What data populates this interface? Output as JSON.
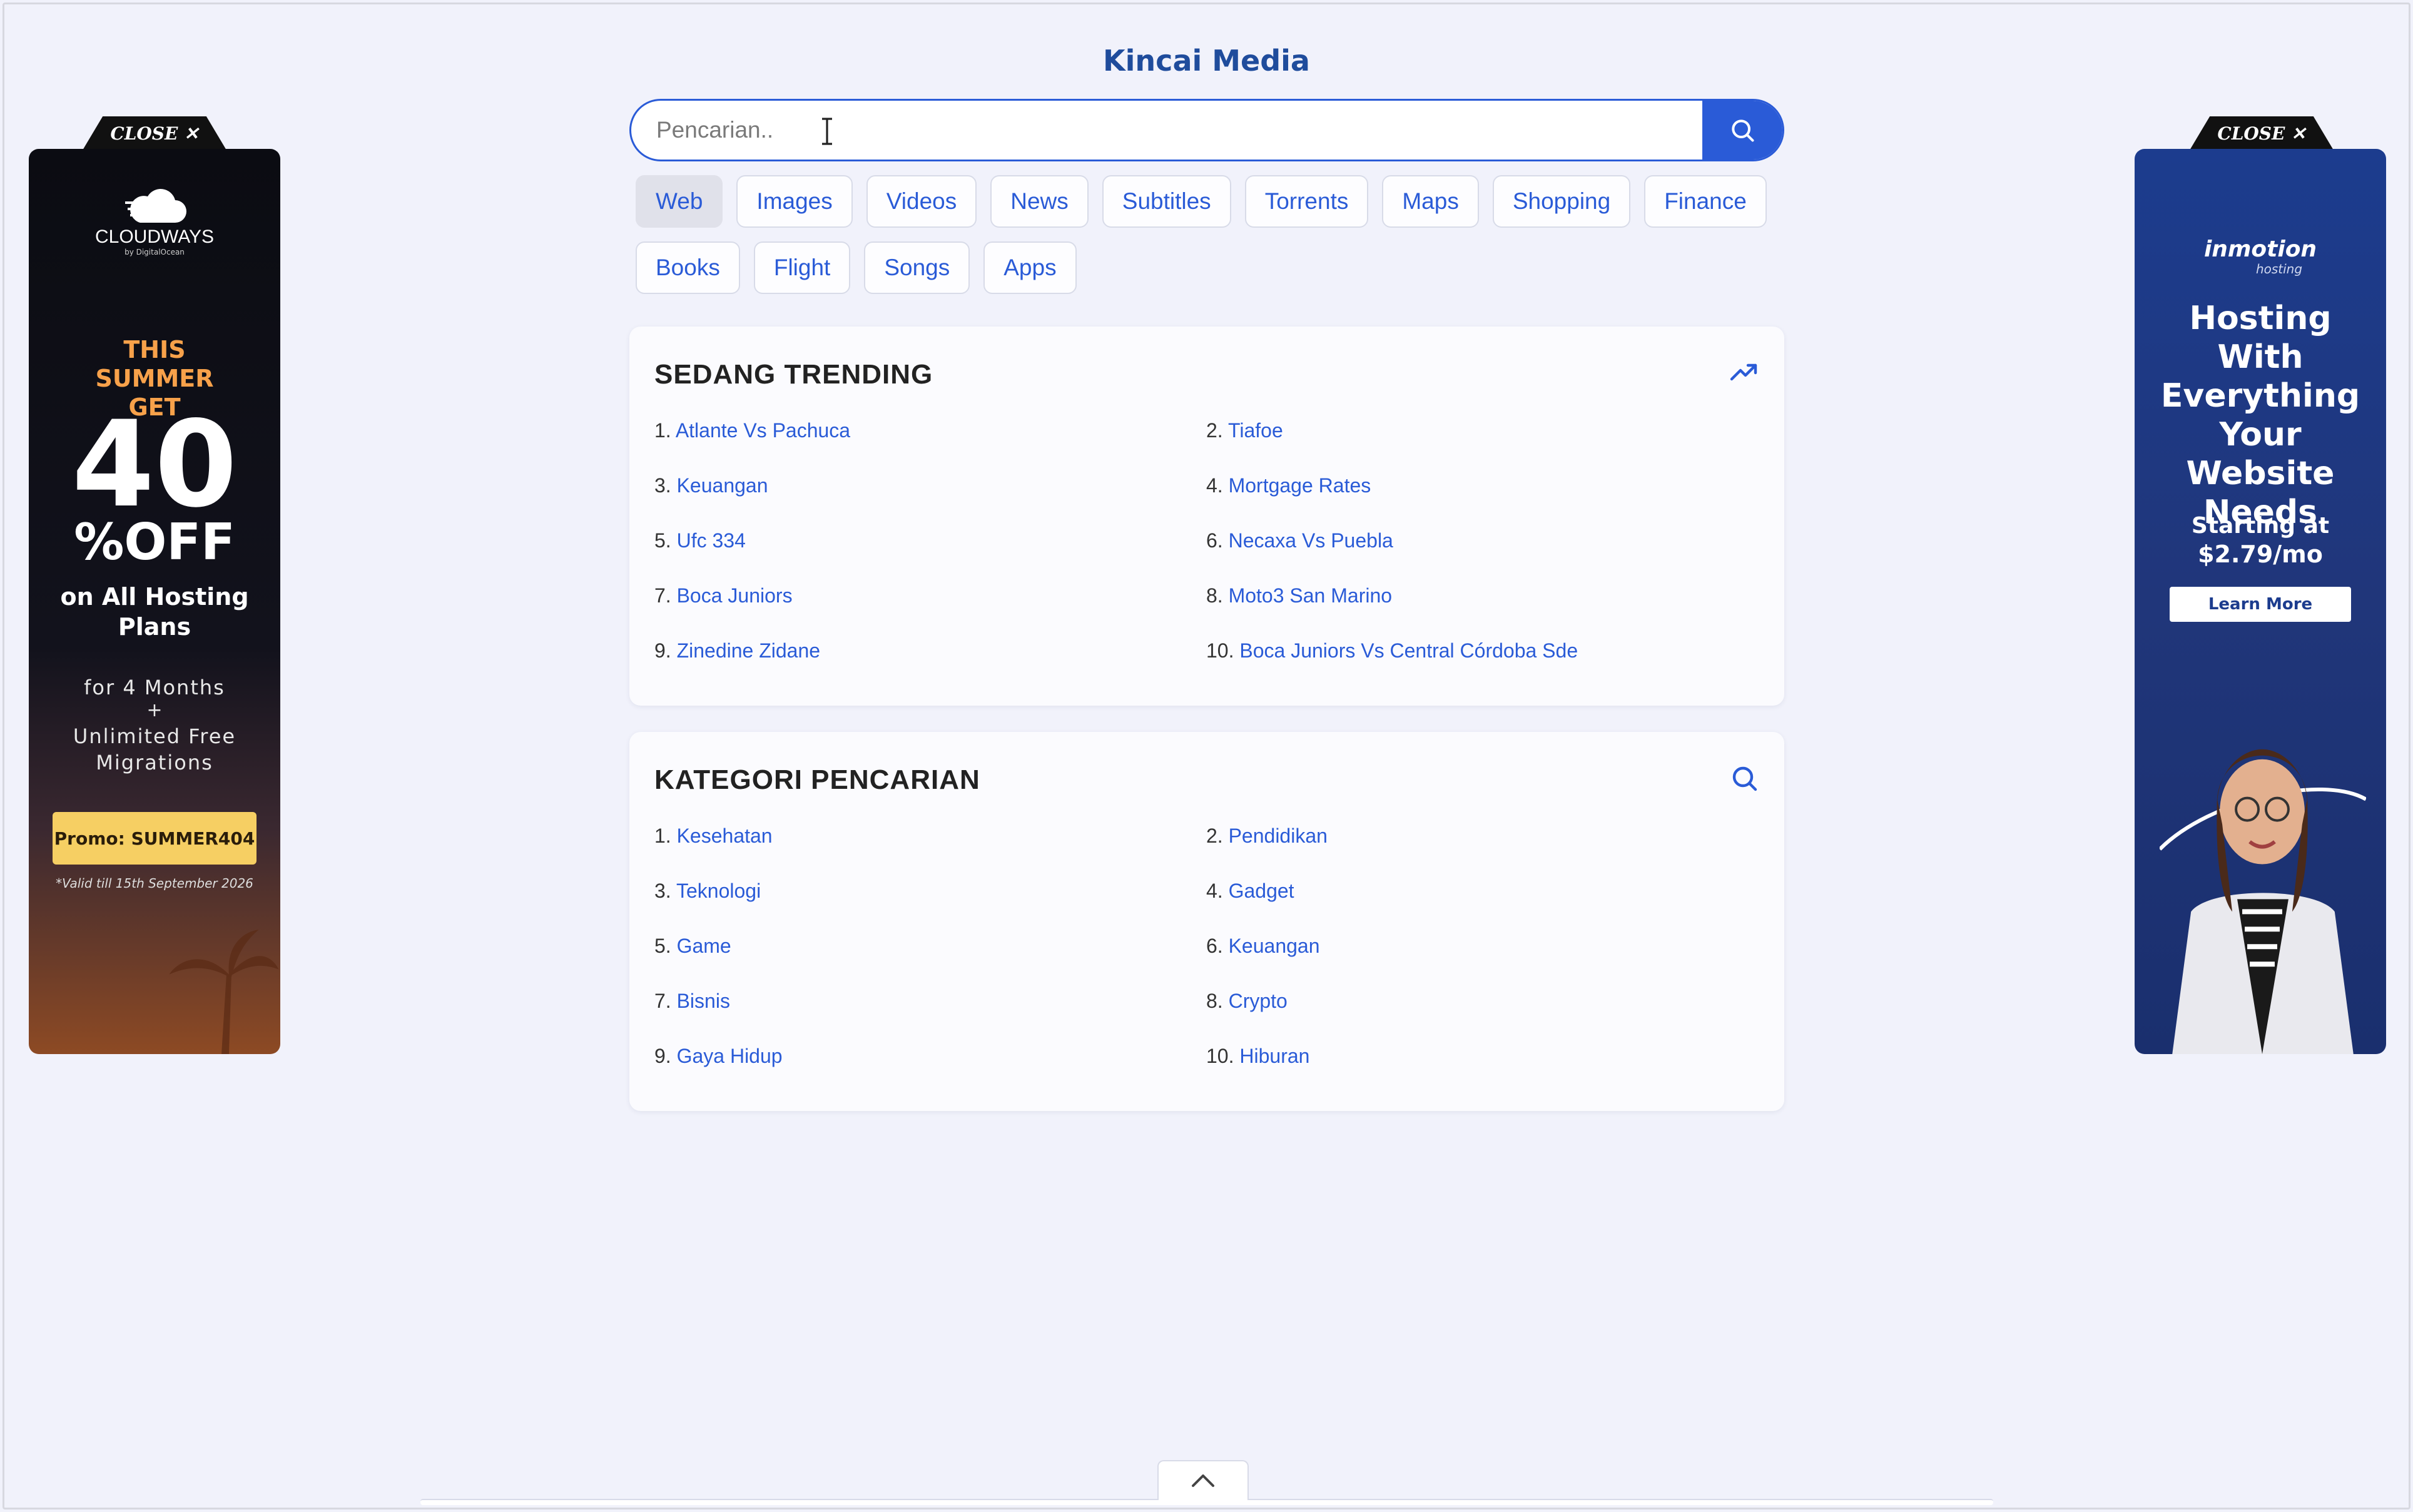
{
  "header": {
    "title": "Kincai Media"
  },
  "search": {
    "placeholder": "Pencarian.."
  },
  "tabs": [
    {
      "label": "Web",
      "active": true
    },
    {
      "label": "Images"
    },
    {
      "label": "Videos"
    },
    {
      "label": "News"
    },
    {
      "label": "Subtitles"
    },
    {
      "label": "Torrents"
    },
    {
      "label": "Maps"
    },
    {
      "label": "Shopping"
    },
    {
      "label": "Finance"
    },
    {
      "label": "Books"
    },
    {
      "label": "Flight"
    },
    {
      "label": "Songs"
    },
    {
      "label": "Apps"
    }
  ],
  "trending": {
    "title": "SEDANG TRENDING",
    "items": [
      {
        "num": "1.",
        "label": "Atlante Vs Pachuca"
      },
      {
        "num": "2.",
        "label": "Tiafoe"
      },
      {
        "num": "3.",
        "label": "Keuangan"
      },
      {
        "num": "4.",
        "label": "Mortgage Rates"
      },
      {
        "num": "5.",
        "label": "Ufc 334"
      },
      {
        "num": "6.",
        "label": "Necaxa Vs Puebla"
      },
      {
        "num": "7.",
        "label": "Boca Juniors"
      },
      {
        "num": "8.",
        "label": "Moto3 San Marino"
      },
      {
        "num": "9.",
        "label": "Zinedine Zidane"
      },
      {
        "num": "10.",
        "label": "Boca Juniors Vs Central Córdoba Sde"
      }
    ]
  },
  "categories": {
    "title": "KATEGORI PENCARIAN",
    "items": [
      {
        "num": "1.",
        "label": "Kesehatan"
      },
      {
        "num": "2.",
        "label": "Pendidikan"
      },
      {
        "num": "3.",
        "label": "Teknologi"
      },
      {
        "num": "4.",
        "label": "Gadget"
      },
      {
        "num": "5.",
        "label": "Game"
      },
      {
        "num": "6.",
        "label": "Keuangan"
      },
      {
        "num": "7.",
        "label": "Bisnis"
      },
      {
        "num": "8.",
        "label": "Crypto"
      },
      {
        "num": "9.",
        "label": "Gaya Hidup"
      },
      {
        "num": "10.",
        "label": "Hiburan"
      }
    ]
  },
  "ad_left": {
    "close": "CLOSE ✕",
    "brand": "CLOUDWAYS",
    "brand_sub": "by DigitalOcean",
    "headline": "THIS SUMMER GET",
    "big": "40",
    "off": "%OFF",
    "plans": "on All Hosting Plans",
    "months": "for 4 Months",
    "plus": "+",
    "migrations": "Unlimited Free Migrations",
    "promo": "Promo: SUMMER404",
    "valid": "*Valid till 15th September 2026"
  },
  "ad_right": {
    "close": "CLOSE ✕",
    "brand": "inmotion",
    "brand_sub": "hosting",
    "headline": "Hosting With Everything Your Website Needs",
    "price_line1": "Starting at",
    "price_line2": "$2.79/mo",
    "cta": "Learn More"
  },
  "colors": {
    "accent": "#2a5bd7",
    "title": "#1f4c9c",
    "background": "#f1f2fb"
  }
}
